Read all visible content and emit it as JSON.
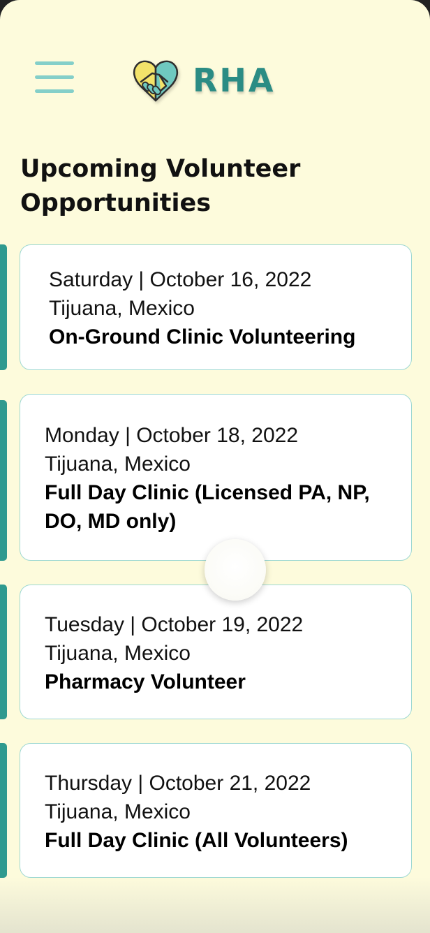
{
  "header": {
    "logo_text": "RHA",
    "colors": {
      "accent": "#2f9a8f",
      "menu": "#84cfc9",
      "logo_yellow": "#f3e36a",
      "logo_teal": "#6fc9c0",
      "background": "#fdfbdc"
    }
  },
  "page": {
    "title_line1": "Upcoming Volunteer",
    "title_line2": "Opportunities"
  },
  "opportunities": [
    {
      "date": "Saturday | October 16, 2022",
      "location": "Tijuana, Mexico",
      "title": "On-Ground Clinic Volunteering"
    },
    {
      "date": "Monday | October 18, 2022",
      "location": "Tijuana, Mexico",
      "title_line1": "Full Day Clinic (Licensed PA, NP,",
      "title_line2": "DO, MD only)"
    },
    {
      "date": "Tuesday | October 19, 2022",
      "location": "Tijuana, Mexico",
      "title": "Pharmacy Volunteer"
    },
    {
      "date": "Thursday | October 21, 2022",
      "location": "Tijuana, Mexico",
      "title": "Full Day Clinic (All Volunteers)"
    }
  ]
}
